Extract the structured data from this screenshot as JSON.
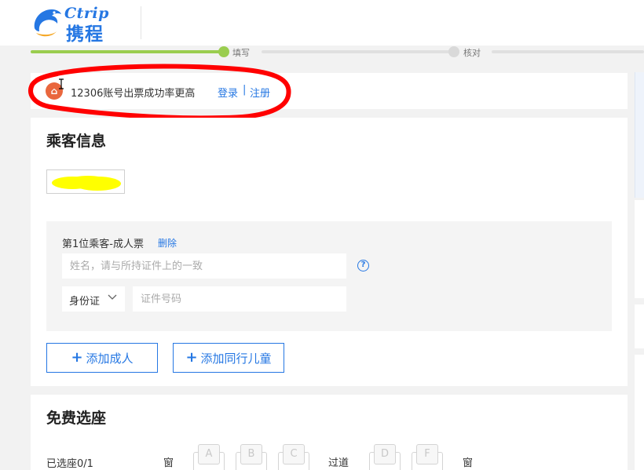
{
  "header": {
    "logo_en": "Ctrip",
    "logo_cn": "携程"
  },
  "progress": {
    "step1": "填写",
    "step2": "核对"
  },
  "banner": {
    "icon_text": "⌂",
    "text": "12306账号出票成功率更高",
    "login": "登录",
    "separator": "|",
    "register": "注册"
  },
  "passenger": {
    "title": "乘客信息",
    "form_label": "第1位乘客-成人票",
    "delete": "删除",
    "name_placeholder": "姓名，请与所持证件上的一致",
    "help": "?",
    "id_type": "身份证",
    "id_placeholder": "证件号码",
    "add_adult": "添加成人",
    "add_child": "添加同行儿童"
  },
  "seat": {
    "title": "免费选座",
    "count": "已选座0/1",
    "window_left": "窗",
    "aisle": "过道",
    "window_right": "窗",
    "seats": [
      "A",
      "B",
      "C",
      "D",
      "F"
    ]
  },
  "colors": {
    "accent": "#2577e3",
    "progress": "#9acd4f",
    "annotation": "#ff0000",
    "highlight": "#ffff00"
  }
}
